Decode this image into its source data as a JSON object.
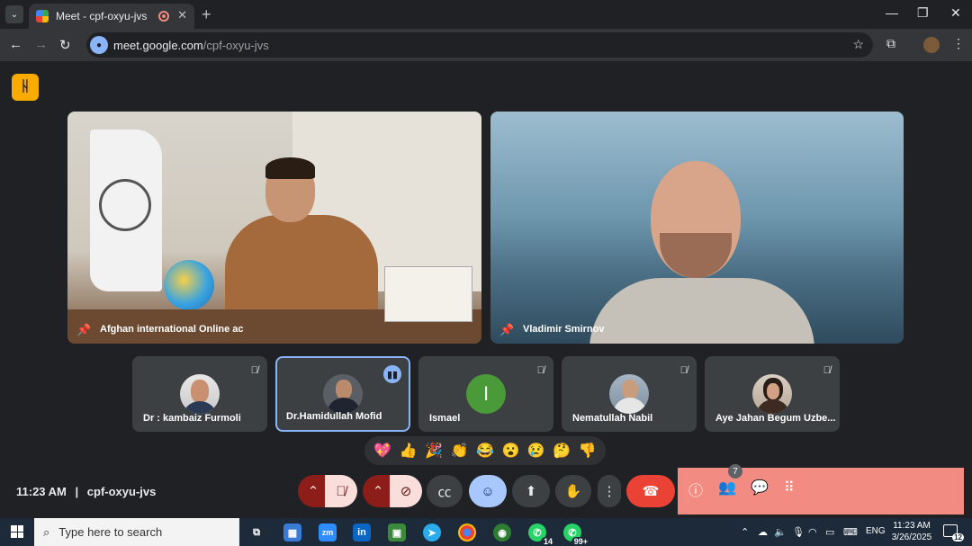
{
  "browser": {
    "tab_title": "Meet - cpf-oxyu-jvs",
    "url_host": "meet.google.com",
    "url_path": "/cpf-oxyu-jvs"
  },
  "meet": {
    "featured": [
      {
        "name": "Afghan international Online ac"
      },
      {
        "name": "Vladimir Smirnov"
      }
    ],
    "participants": [
      {
        "name": "Dr : kambaiz Furmoli",
        "muted": true,
        "active": false
      },
      {
        "name": "Dr.Hamidullah Mofid",
        "muted": false,
        "active": true
      },
      {
        "name": "Ismael",
        "initial": "I",
        "avatar_color": "#4a9a3a",
        "muted": true,
        "active": false
      },
      {
        "name": "Nematullah Nabil",
        "muted": true,
        "active": false
      },
      {
        "name": "Aye Jahan Begum Uzbe...",
        "muted": true,
        "active": false
      }
    ],
    "reactions": [
      "💖",
      "👍",
      "🎉",
      "👏",
      "😂",
      "😮",
      "😢",
      "🤔",
      "👎"
    ],
    "time": "11:23 AM",
    "separator": "|",
    "meeting_code": "cpf-oxyu-jvs",
    "people_count": "7"
  },
  "taskbar": {
    "search_placeholder": "Type here to search",
    "whatsapp_count": "14",
    "whatsapp2_count": "99+",
    "lang": "ENG",
    "time": "11:23 AM",
    "date": "3/26/2025",
    "notifications": "12"
  }
}
